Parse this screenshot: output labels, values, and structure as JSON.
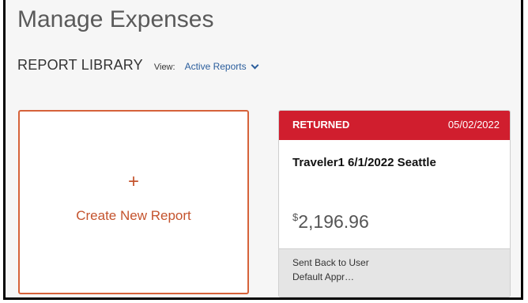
{
  "header": {
    "title": "Manage Expenses"
  },
  "library": {
    "title": "REPORT LIBRARY",
    "view_label": "View:",
    "view_selected": "Active Reports",
    "view_icon": "chevron-down-icon"
  },
  "create_card": {
    "icon": "plus-icon",
    "plus_glyph": "+",
    "label": "Create New Report"
  },
  "reports": [
    {
      "status": "RETURNED",
      "date": "05/02/2022",
      "name": "Traveler1 6/1/2022 Seattle",
      "currency_symbol": "$",
      "amount": "2,196.96",
      "footer_line1": "Sent Back to User",
      "footer_line2": "Default Appr…"
    }
  ],
  "colors": {
    "status_returned": "#d01e2e",
    "create_accent": "#c4532d",
    "link_blue": "#2a5d9c"
  }
}
